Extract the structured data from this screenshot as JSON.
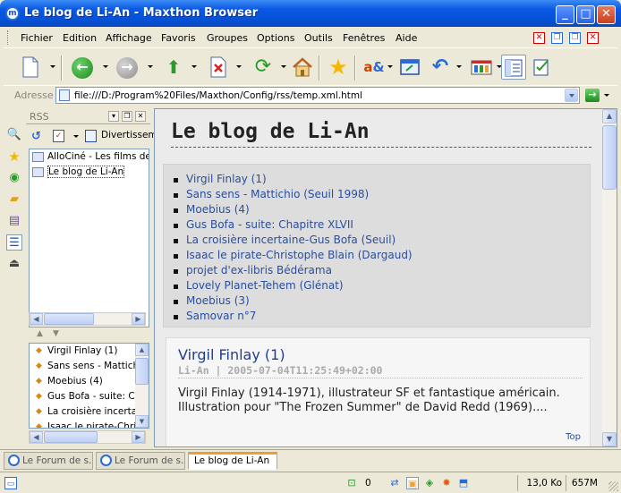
{
  "window": {
    "title": "Le blog de Li-An - Maxthon Browser"
  },
  "menu": [
    "Fichier",
    "Edition",
    "Affichage",
    "Favoris",
    "Groupes",
    "Options",
    "Outils",
    "Fenêtres",
    "Aide"
  ],
  "address": {
    "label": "Adresse",
    "url": "file:///D:/Program%20Files/Maxthon/Config/rss/temp.xml.html"
  },
  "rss_sidebar": {
    "header": "RSS",
    "category": "Divertissem",
    "feeds": [
      "AlloCiné - Les films de la",
      "Le blog de Li-An"
    ],
    "items": [
      "Virgil Finlay (1)",
      "Sans sens - Mattich",
      "Moebius (4)",
      "Gus Bofa - suite: Ch",
      "La croisière incertai",
      "Isaac le pirate-Chris"
    ]
  },
  "page": {
    "title": "Le blog de Li-An",
    "toc": [
      "Virgil Finlay (1)",
      "Sans sens - Mattichio (Seuil 1998)",
      "Moebius (4)",
      "Gus Bofa - suite: Chapitre XLVII",
      "La croisière incertaine-Gus Bofa (Seuil)",
      "Isaac le pirate-Christophe Blain (Dargaud)",
      "projet d'ex-libris Bédérama",
      "Lovely Planet-Tehem (Glénat)",
      "Moebius (3)",
      "Samovar n°7"
    ],
    "post": {
      "title": "Virgil Finlay (1)",
      "meta": "Li-An | 2005-07-04T11:25:49+02:00",
      "body": "Virgil Finlay (1914-1971), illustrateur SF et fantastique américain. Illustration pour \"The Frozen Summer\" de David Redd (1969)....",
      "top_link": "Top"
    }
  },
  "tabs": [
    "Le Forum de s...",
    "Le Forum de s...",
    "Le blog de Li-An"
  ],
  "status": {
    "count": "0",
    "size": "13,0 Ko",
    "memory": "657M"
  },
  "colors": {
    "titlebar": "#0553D8",
    "link": "#2A4E9C",
    "post_title": "#1E3F8C",
    "active_tab_accent": "#F0A030"
  }
}
